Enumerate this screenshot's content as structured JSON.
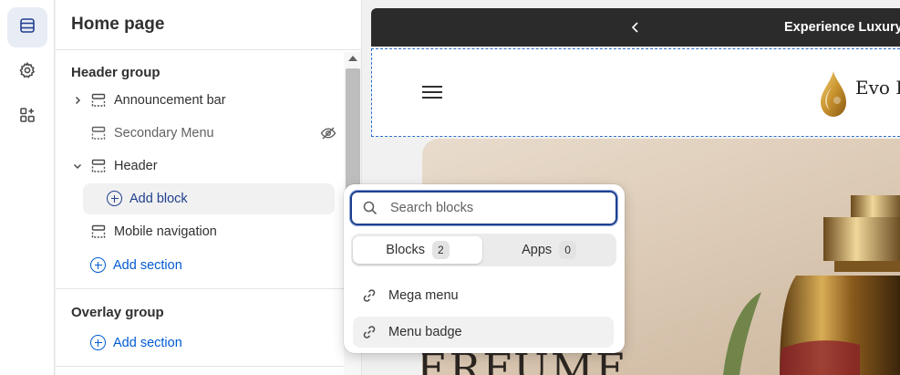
{
  "rail": {
    "items": [
      {
        "icon": "sections-icon",
        "active": true
      },
      {
        "icon": "gear-icon",
        "active": false
      },
      {
        "icon": "apps-icon",
        "active": false
      }
    ]
  },
  "sidebar": {
    "title": "Home page",
    "header_group": {
      "title": "Header group",
      "sections": [
        {
          "label": "Announcement bar",
          "expandable": true,
          "hidden": false
        },
        {
          "label": "Secondary Menu",
          "expandable": false,
          "hidden": true
        },
        {
          "label": "Header",
          "expandable": true,
          "expanded": true,
          "hidden": false
        },
        {
          "label": "Mobile navigation",
          "expandable": false,
          "hidden": false
        }
      ],
      "add_block": "Add block",
      "add_section": "Add section"
    },
    "overlay_group": {
      "title": "Overlay group",
      "add_section": "Add section"
    }
  },
  "preview": {
    "announcement_text": "Experience Luxury, F",
    "logo_text": "Evo P",
    "hero_text": "ERFUME"
  },
  "popover": {
    "search_placeholder": "Search blocks",
    "tabs": [
      {
        "label": "Blocks",
        "count": "2",
        "active": true
      },
      {
        "label": "Apps",
        "count": "0",
        "active": false
      }
    ],
    "items": [
      {
        "label": "Mega menu",
        "hover": false
      },
      {
        "label": "Menu badge",
        "hover": true
      }
    ]
  },
  "colors": {
    "accent": "#005bd3",
    "focus": "#1f3f8f",
    "announcement_bg": "#2b2b2b"
  }
}
